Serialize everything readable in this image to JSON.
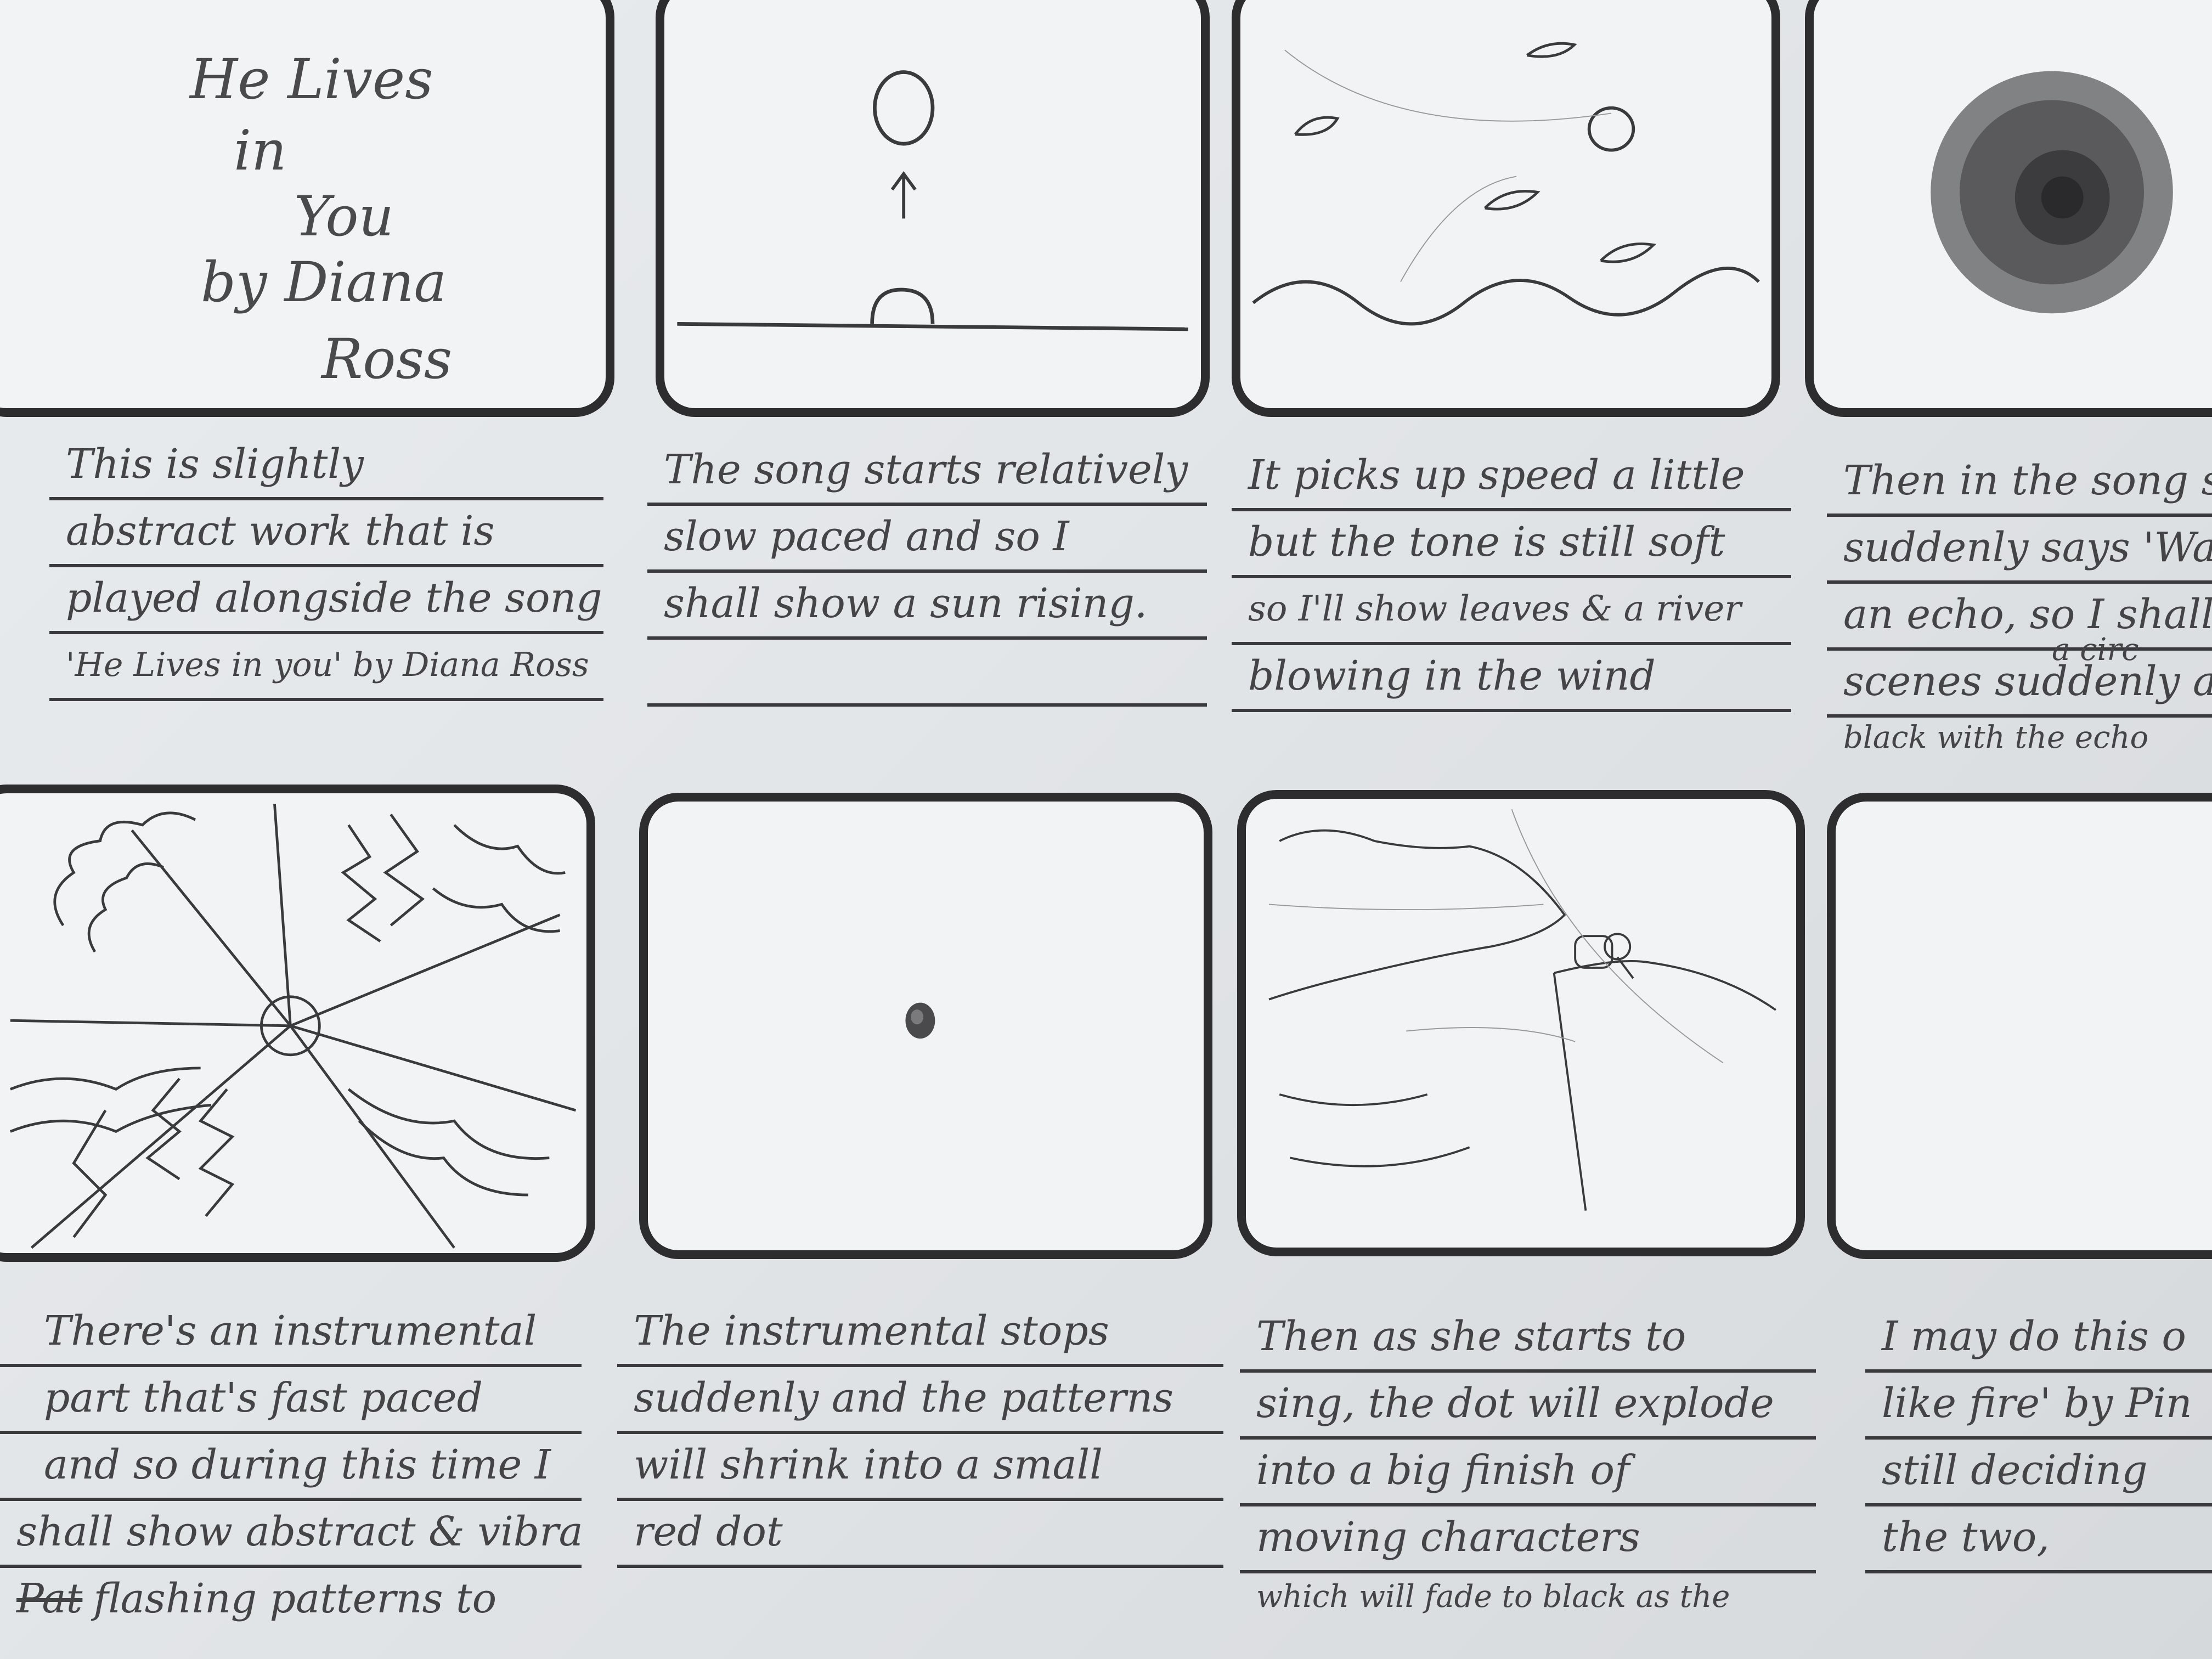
{
  "title_card": {
    "line1": "He Lives",
    "line2": "in",
    "line3": "You",
    "line4": "by Diana",
    "line5": "Ross"
  },
  "captions": [
    [
      "This is slightly",
      "abstract work that is",
      "played alongside the song",
      "'He Lives in you' by Diana Ross"
    ],
    [
      "The song starts relatively",
      "slow paced and so I",
      "shall show a sun rising.",
      ""
    ],
    [
      "It picks up speed a little",
      "but the tone is still soft",
      "so I'll show leaves & a river",
      "blowing in the wind"
    ],
    [
      "Then in the song sh",
      "suddenly says 'Wait",
      "an echo, so I shall cha",
      "scenes suddenly and s",
      "black with the echo"
    ],
    [
      "There's an instrumental",
      "part that's fast paced",
      "and so during this time I",
      "shall show abstract & vibrant",
      "flashing patterns to"
    ],
    [
      "The instrumental stops",
      "suddenly and the patterns",
      "will shrink into a small",
      "red dot",
      ""
    ],
    [
      "Then as she starts to",
      "sing, the dot will explode",
      "into a big finish of",
      "moving characters",
      "which will fade to black as the"
    ],
    [
      "I may do this o",
      "like fire' by Pin",
      "still deciding",
      "the two,",
      ""
    ]
  ],
  "annotations": {
    "small_above_circle": "a circ",
    "struck_word": "Pat"
  }
}
